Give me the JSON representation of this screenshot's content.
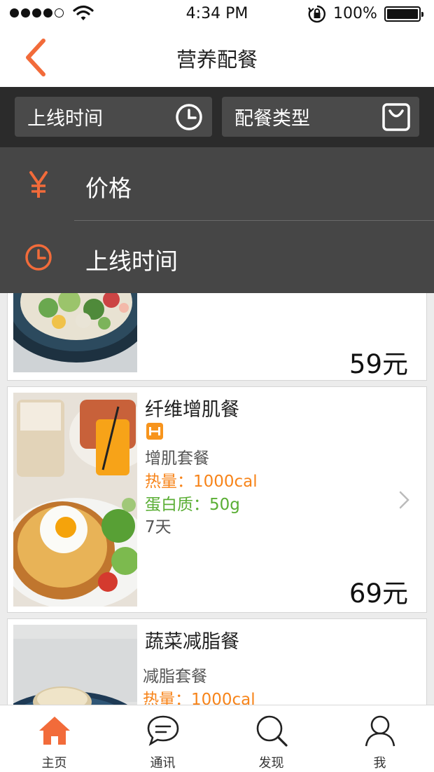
{
  "status_bar": {
    "time": "4:34 PM",
    "battery": "100%"
  },
  "nav": {
    "title": "营养配餐"
  },
  "filters": [
    {
      "label": "上线时间",
      "icon": "clock-icon"
    },
    {
      "label": "配餐类型",
      "icon": "bag-icon"
    }
  ],
  "dropdown": [
    {
      "label": "价格",
      "icon": "yen-icon"
    },
    {
      "label": "上线时间",
      "icon": "clock-icon"
    }
  ],
  "meals": [
    {
      "price": "59元"
    },
    {
      "title": "纤维增肌餐",
      "type": "增肌套餐",
      "calories": "热量：1000cal",
      "protein": "蛋白质：50g",
      "duration": "7天",
      "price": "69元"
    },
    {
      "title": "蔬菜减脂餐",
      "type": "减脂套餐",
      "calories": "热量：1000cal"
    }
  ],
  "tabs": [
    {
      "label": "主页",
      "icon": "home-icon",
      "active": true
    },
    {
      "label": "通讯",
      "icon": "chat-icon",
      "active": false
    },
    {
      "label": "发现",
      "icon": "search-icon",
      "active": false
    },
    {
      "label": "我",
      "icon": "user-icon",
      "active": false
    }
  ],
  "colors": {
    "accent": "#f26b3a",
    "calorie": "#f7841a",
    "protein": "#5aae34",
    "dark_bar": "#2b2b2b",
    "dropdown": "#464646"
  }
}
